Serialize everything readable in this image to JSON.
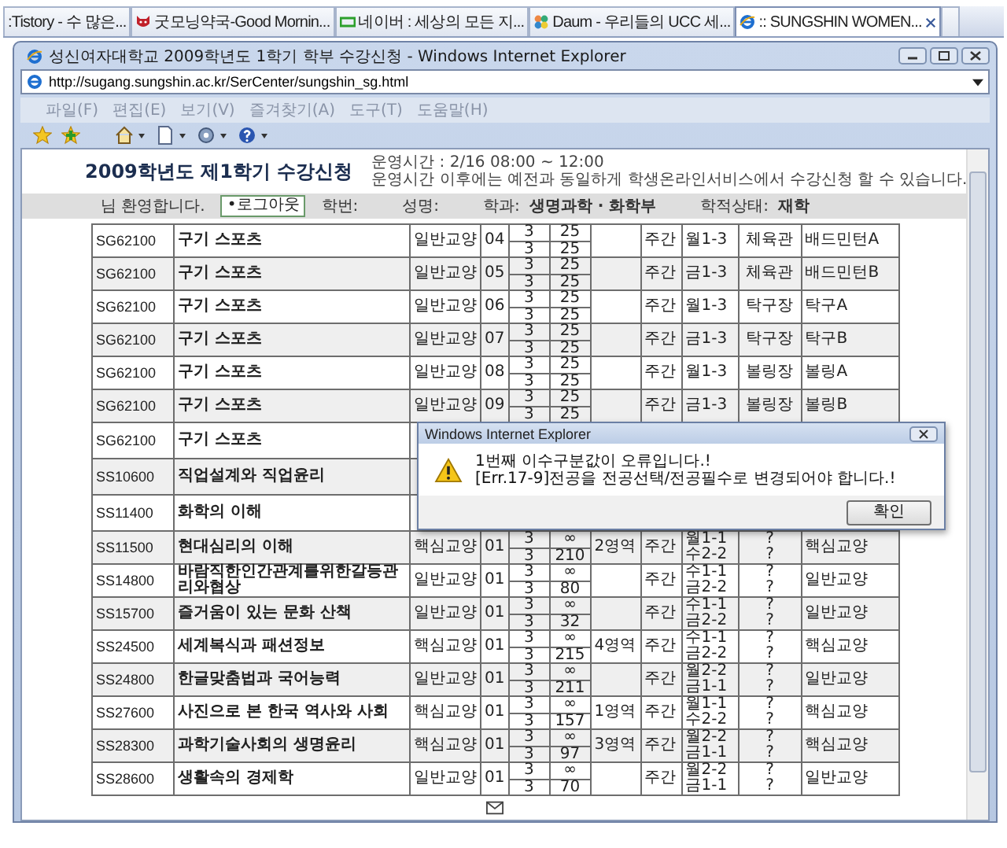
{
  "tab_bar": {
    "tabs": [
      {
        "label": ":Tistory - 수 많은...",
        "selected": false
      },
      {
        "label": "굿모닝약국-Good Mornin...",
        "selected": false
      },
      {
        "label": "네이버 : 세상의 모든 지...",
        "selected": false
      },
      {
        "label": "Daum - 우리들의 UCC 세...",
        "selected": false
      },
      {
        "label": ":: SUNGSHIN WOMEN...",
        "selected": true
      }
    ]
  },
  "window": {
    "title": "성신여자대학교 2009학년도 1학기 학부 수강신청 - Windows Internet Explorer",
    "address": "http://sugang.sungshin.ac.kr/SerCenter/sungshin_sg.html",
    "menu": [
      "파일(F)",
      "편집(E)",
      "보기(V)",
      "즐겨찾기(A)",
      "도구(T)",
      "도움말(H)"
    ]
  },
  "page": {
    "title": "2009학년도 제1학기 수강신청",
    "notice": [
      "운영시간 : 2/16 08:00 ~ 12:00",
      "운영시간 이후에는 예전과 동일하게 학생온라인서비스에서 수강신청 할 수 있습니다."
    ],
    "user_bar": {
      "welcome": "님 환영합니다.",
      "logout_button": "•로그아웃",
      "fields": [
        {
          "label": "학번:"
        },
        {
          "label": "성명:"
        },
        {
          "label": "학과:",
          "value": "생명과학 · 화학부"
        },
        {
          "label": "학적상태:",
          "value": "재학"
        }
      ]
    }
  },
  "table": {
    "rows": [
      {
        "code": "SG62100",
        "name": "구기 스포츠",
        "category": "일반교양",
        "section": "04",
        "credits": [
          "3",
          "3"
        ],
        "capacity": [
          "25",
          "25"
        ],
        "shift": "주간",
        "time": [
          "월1-3"
        ],
        "room": [
          "체육관"
        ],
        "class": "배드민턴A"
      },
      {
        "code": "SG62100",
        "name": "구기 스포츠",
        "category": "일반교양",
        "section": "05",
        "credits": [
          "3",
          "3"
        ],
        "capacity": [
          "25",
          "25"
        ],
        "shift": "주간",
        "time": [
          "금1-3"
        ],
        "room": [
          "체육관"
        ],
        "class": "배드민턴B"
      },
      {
        "code": "SG62100",
        "name": "구기 스포츠",
        "category": "일반교양",
        "section": "06",
        "credits": [
          "3",
          "3"
        ],
        "capacity": [
          "25",
          "25"
        ],
        "shift": "주간",
        "time": [
          "월1-3"
        ],
        "room": [
          "탁구장"
        ],
        "class": "탁구A"
      },
      {
        "code": "SG62100",
        "name": "구기 스포츠",
        "category": "일반교양",
        "section": "07",
        "credits": [
          "3",
          "3"
        ],
        "capacity": [
          "25",
          "25"
        ],
        "shift": "주간",
        "time": [
          "금1-3"
        ],
        "room": [
          "탁구장"
        ],
        "class": "탁구B"
      },
      {
        "code": "SG62100",
        "name": "구기 스포츠",
        "category": "일반교양",
        "section": "08",
        "credits": [
          "3",
          "3"
        ],
        "capacity": [
          "25",
          "25"
        ],
        "shift": "주간",
        "time": [
          "월1-3"
        ],
        "room": [
          "볼링장"
        ],
        "class": "볼링A"
      },
      {
        "code": "SG62100",
        "name": "구기 스포츠",
        "category": "일반교양",
        "section": "09",
        "credits": [
          "3",
          "3"
        ],
        "capacity": [
          "25",
          "25"
        ],
        "shift": "주간",
        "time": [
          "금1-3"
        ],
        "room": [
          "볼링장"
        ],
        "class": "볼링B"
      },
      {
        "code": "SG62100",
        "name": "구기 스포츠"
      },
      {
        "code": "SS10600",
        "name": "직업설계와 직업윤리"
      },
      {
        "code": "SS11400",
        "name": "화학의 이해"
      },
      {
        "code": "SS11500",
        "name": "현대심리의 이해",
        "category": "핵심교양",
        "section": "01",
        "credits": [
          "3",
          "3"
        ],
        "capacity": [
          "∞",
          "210"
        ],
        "area": "2영역",
        "shift": "주간",
        "time": [
          "월1-1",
          "수2-2"
        ],
        "room": [
          "?",
          "?"
        ],
        "class": "핵심교양"
      },
      {
        "code": "SS14800",
        "name": "바람직한인간관계를위한갈등관리와협상",
        "category": "일반교양",
        "section": "01",
        "credits": [
          "3",
          "3"
        ],
        "capacity": [
          "∞",
          "80"
        ],
        "shift": "주간",
        "time": [
          "수1-1",
          "금2-2"
        ],
        "room": [
          "?",
          "?"
        ],
        "class": "일반교양"
      },
      {
        "code": "SS15700",
        "name": "즐거움이 있는 문화 산책",
        "category": "일반교양",
        "section": "01",
        "credits": [
          "3",
          "3"
        ],
        "capacity": [
          "∞",
          "32"
        ],
        "shift": "주간",
        "time": [
          "수1-1",
          "금2-2"
        ],
        "room": [
          "?",
          "?"
        ],
        "class": "일반교양"
      },
      {
        "code": "SS24500",
        "name": "세계복식과 패션정보",
        "category": "핵심교양",
        "section": "01",
        "credits": [
          "3",
          "3"
        ],
        "capacity": [
          "∞",
          "215"
        ],
        "area": "4영역",
        "shift": "주간",
        "time": [
          "수1-1",
          "금2-2"
        ],
        "room": [
          "?",
          "?"
        ],
        "class": "핵심교양"
      },
      {
        "code": "SS24800",
        "name": "한글맞춤법과 국어능력",
        "category": "일반교양",
        "section": "01",
        "credits": [
          "3",
          "3"
        ],
        "capacity": [
          "∞",
          "211"
        ],
        "shift": "주간",
        "time": [
          "월2-2",
          "금1-1"
        ],
        "room": [
          "?",
          "?"
        ],
        "class": "일반교양"
      },
      {
        "code": "SS27600",
        "name": "사진으로 본 한국 역사와 사회",
        "category": "핵심교양",
        "section": "01",
        "credits": [
          "3",
          "3"
        ],
        "capacity": [
          "∞",
          "157"
        ],
        "area": "1영역",
        "shift": "주간",
        "time": [
          "월1-1",
          "수2-2"
        ],
        "room": [
          "?",
          "?"
        ],
        "class": "핵심교양"
      },
      {
        "code": "SS28300",
        "name": "과학기술사회의 생명윤리",
        "category": "핵심교양",
        "section": "01",
        "credits": [
          "3",
          "3"
        ],
        "capacity": [
          "∞",
          "97"
        ],
        "area": "3영역",
        "shift": "주간",
        "time": [
          "월2-2",
          "금1-1"
        ],
        "room": [
          "?",
          "?"
        ],
        "class": "핵심교양"
      },
      {
        "code": "SS28600",
        "name": "생활속의 경제학",
        "category": "일반교양",
        "section": "01",
        "credits": [
          "3",
          "3"
        ],
        "capacity": [
          "∞",
          "70"
        ],
        "shift": "주간",
        "time": [
          "월2-2",
          "금1-1"
        ],
        "room": [
          "?",
          "?"
        ],
        "class": "일반교양"
      }
    ]
  },
  "dialog": {
    "title": "Windows Internet Explorer",
    "message": [
      "1번째 이수구분값이 오류입니다.!",
      "[Err.17-9]전공을 전공선택/전공필수로 변경되어야 합니다.!"
    ],
    "button": "확인"
  }
}
